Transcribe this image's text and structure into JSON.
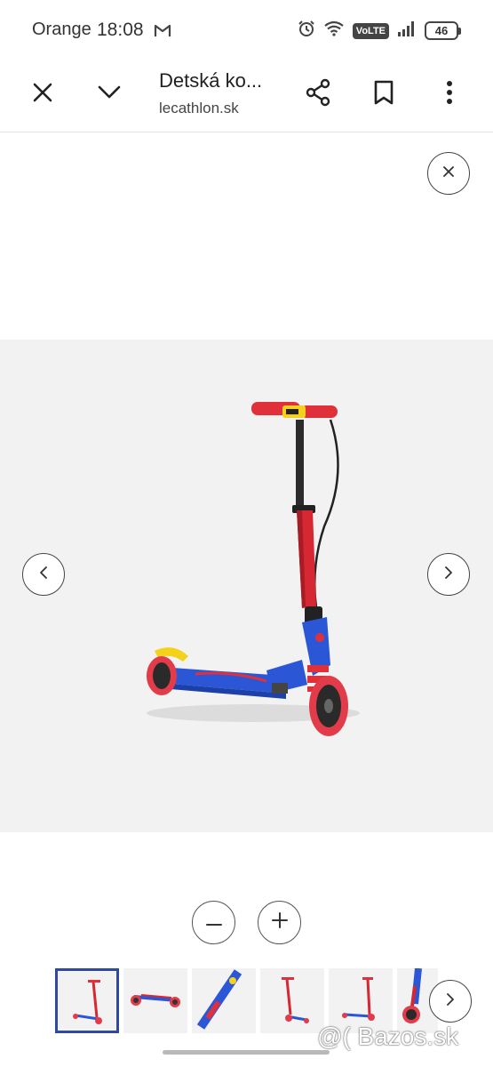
{
  "status_bar": {
    "carrier": "Orange",
    "time": "18:08",
    "network_badge": "VoLTE",
    "battery_level": "46",
    "icons": [
      "gmail-icon",
      "alarm-icon",
      "wifi-icon",
      "signal-icon",
      "battery-icon"
    ]
  },
  "top_bar": {
    "title": "Detská ko...",
    "domain": "lecathlon.sk",
    "icons": [
      "close-icon",
      "chevron-down-icon",
      "share-icon",
      "bookmark-icon",
      "more-vert-icon"
    ]
  },
  "viewer": {
    "icons": [
      "close-icon",
      "chevron-left-icon",
      "chevron-right-icon",
      "minus-icon",
      "plus-icon"
    ],
    "product_colors": {
      "background": "#f2f2f2",
      "frame_blue": "#2b57d6",
      "stem_red": "#d62833",
      "grip_red": "#e0313b",
      "accent_yellow": "#f4d21c",
      "wheel_red": "#e23b4a"
    },
    "thumbnails": [
      {
        "selected": true
      },
      {
        "selected": false
      },
      {
        "selected": false
      },
      {
        "selected": false
      },
      {
        "selected": false
      },
      {
        "selected": false
      }
    ],
    "selection_color": "#2f49a0"
  },
  "watermark": "@( Bazos.sk"
}
